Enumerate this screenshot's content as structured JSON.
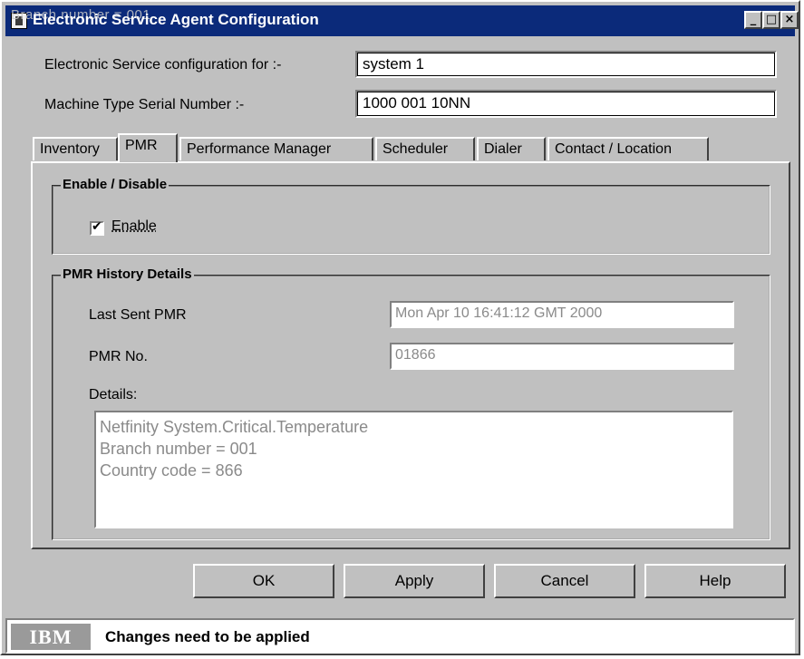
{
  "window": {
    "title": "Electronic Service Agent Configuration",
    "title_overlay_text": "Branch number = 001",
    "minimize": "_",
    "maximize": "□",
    "close": "×"
  },
  "form": {
    "config_label": "Electronic Service configuration for :-",
    "config_value": "system 1",
    "serial_label": "Machine Type Serial Number :-",
    "serial_value": "1000 001 10NN"
  },
  "tabs": [
    {
      "label": "Inventory"
    },
    {
      "label": "PMR",
      "active": true
    },
    {
      "label": "Performance Manager"
    },
    {
      "label": "Scheduler"
    },
    {
      "label": "Dialer"
    },
    {
      "label": "Contact / Location"
    }
  ],
  "enable_group": {
    "title": "Enable / Disable",
    "checkbox_label": "Enable",
    "checked": true
  },
  "history_group": {
    "title": "PMR History Details",
    "last_sent_label": "Last Sent PMR",
    "last_sent_value": "Mon Apr 10 16:41:12 GMT 2000",
    "pmr_no_label": "PMR No.",
    "pmr_no_value": "01866",
    "details_label": "Details:",
    "details_lines": [
      "Netfinity System.Critical.Temperature",
      "Branch number = 001",
      "Country code = 866"
    ]
  },
  "buttons": {
    "ok": "OK",
    "apply": "Apply",
    "cancel": "Cancel",
    "help": "Help"
  },
  "status": {
    "logo": "IBM",
    "message": "Changes need to be applied"
  },
  "colors": {
    "title_bar": "#0b2a7a",
    "dialog_bg": "#c0c0c0"
  }
}
